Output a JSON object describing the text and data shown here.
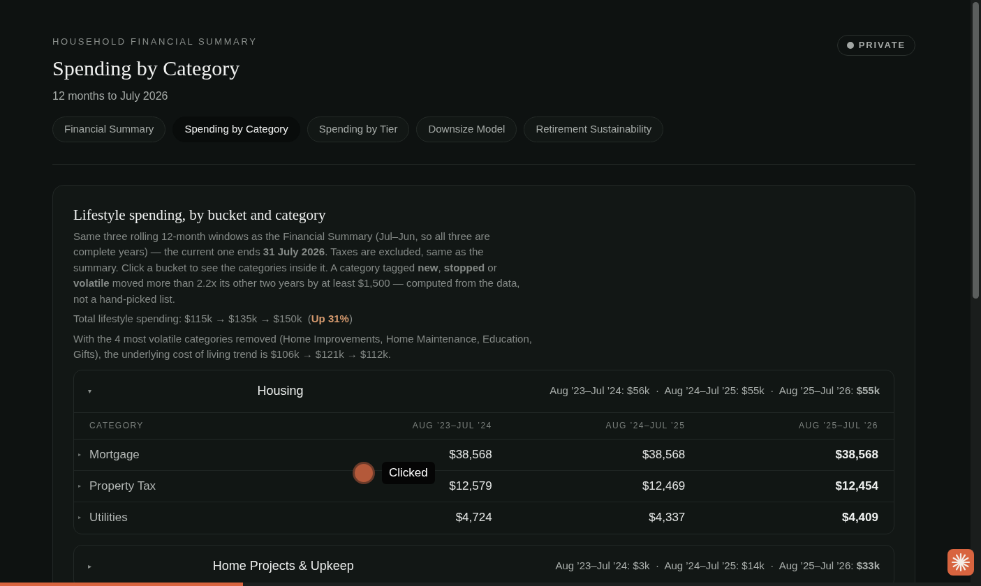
{
  "header": {
    "eyebrow": "HOUSEHOLD FINANCIAL SUMMARY",
    "title": "Spending by Category",
    "subtitle": "12 months to July 2026",
    "badge": {
      "label": "PRIVATE",
      "color": "#a3a7a5"
    }
  },
  "tabs": [
    {
      "label": "Financial Summary",
      "selected": false
    },
    {
      "label": "Spending by Category",
      "selected": true
    },
    {
      "label": "Spending by Tier",
      "selected": false
    },
    {
      "label": "Downsize Model",
      "selected": false
    },
    {
      "label": "Retirement Sustainability",
      "selected": false
    }
  ],
  "card": {
    "title": "Lifestyle spending, by bucket and category",
    "intro": "Same three rolling 12-month windows as the Financial Summary (Jul–Jun, so all three are complete years) — the current one ends **31 July 2026**. Taxes are excluded, same as the summary. Click a bucket to see the categories inside it. A category tagged **new**, **stopped** or **volatile** moved more than 2.2x its other two years by at least $1,500 — computed from the data, not a hand-picked list.",
    "total": {
      "prefix": "Total lifestyle spending: $115k → $135k → $150k  (",
      "change": "Up 31%",
      "suffix": ")"
    },
    "note": "With the 4 most volatile categories removed (Home Improvements, Home Maintenance, Education, Gifts), the underlying cost of living trend is $106k → $121k → $112k.",
    "buckets": [
      {
        "toggle": "▾",
        "name": "Housing",
        "expanded": true,
        "totals": "Aug ’23–Jul ’24: $56k  ·  Aug ’24–Jul ’25: $55k  ·  Aug ’25–Jul ’26: **$55k**",
        "columns": [
          "CATEGORY",
          "AUG ’23–JUL ’24",
          "AUG ’24–JUL ’25",
          "AUG ’25–JUL ’26"
        ],
        "rows": [
          {
            "toggle": "▸",
            "cells": [
              "Mortgage",
              "$38,568",
              "$38,568",
              "$38,568"
            ]
          },
          {
            "toggle": "▸",
            "cells": [
              "Property Tax",
              "$12,579",
              "$12,469",
              "$12,454"
            ]
          },
          {
            "toggle": "▸",
            "cells": [
              "Utilities",
              "$4,724",
              "$4,337",
              "$4,409"
            ]
          }
        ]
      },
      {
        "toggle": "▸",
        "name": "Home Projects & Upkeep",
        "expanded": false,
        "totals": "Aug ’23–Jul ’24: $3k  ·  Aug ’24–Jul ’25: $14k  ·  Aug ’25–Jul ’26: **$33k**"
      }
    ]
  },
  "click_marker": {
    "label": "Clicked"
  },
  "progress": {
    "level": 0.25
  }
}
